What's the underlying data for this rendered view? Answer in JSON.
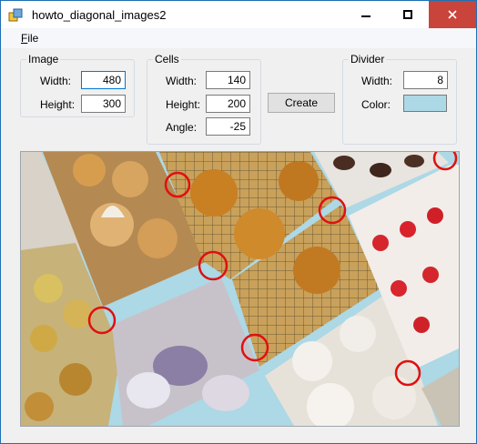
{
  "window": {
    "title": "howto_diagonal_images2"
  },
  "menu": {
    "file": "File",
    "file_mnemonic": "F",
    "file_rest": "ile"
  },
  "image_group": {
    "title": "Image",
    "width_label": "Width:",
    "width_value": "480",
    "height_label": "Height:",
    "height_value": "300"
  },
  "cells_group": {
    "title": "Cells",
    "width_label": "Width:",
    "width_value": "140",
    "height_label": "Height:",
    "height_value": "200",
    "angle_label": "Angle:",
    "angle_value": "-25"
  },
  "create_button": "Create",
  "divider_group": {
    "title": "Divider",
    "width_label": "Width:",
    "width_value": "8",
    "color_label": "Color:",
    "color": "#add8e6"
  },
  "colors": {
    "accent": "#0078d7",
    "close": "#c9453c",
    "marker": "#e01010",
    "divider": "#add8e6"
  },
  "icons": [
    "app-icon",
    "minimize-icon",
    "maximize-icon",
    "close-icon"
  ]
}
